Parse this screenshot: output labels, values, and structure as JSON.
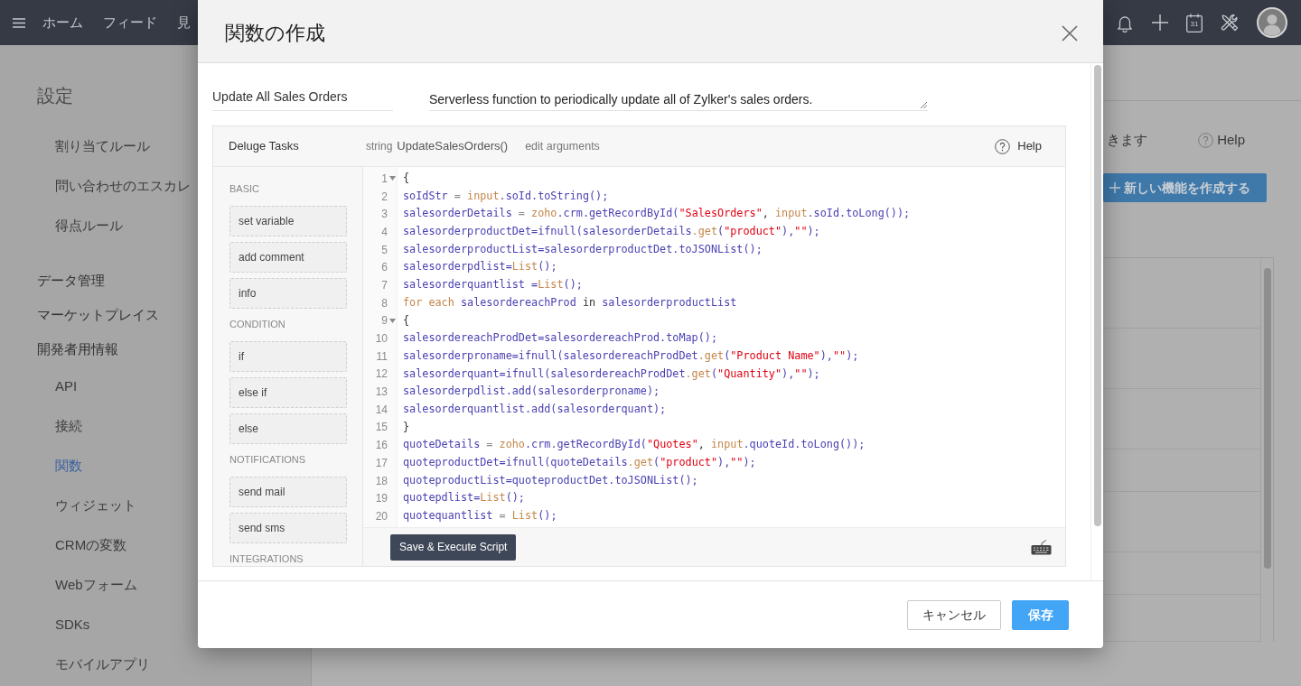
{
  "topbar": {
    "nav": [
      {
        "label": "ホーム",
        "selected": false
      },
      {
        "label": "フィード",
        "selected": false
      },
      {
        "label": "見",
        "selected": false
      }
    ],
    "calendar_day": "31"
  },
  "sidebar": {
    "title": "設定",
    "sections": [
      {
        "items": [
          {
            "label": "割り当てルール",
            "selected": false
          },
          {
            "label": "問い合わせのエスカレ",
            "selected": false
          },
          {
            "label": "得点ルール",
            "selected": false
          }
        ]
      },
      {
        "heading": "データ管理"
      },
      {
        "heading": "マーケットプレイス"
      },
      {
        "heading": "開発者用情報",
        "items": [
          {
            "label": "API",
            "selected": false
          },
          {
            "label": "接続",
            "selected": false
          },
          {
            "label": "関数",
            "selected": true
          },
          {
            "label": "ウィジェット",
            "selected": false
          },
          {
            "label": "CRMの変数",
            "selected": false
          },
          {
            "label": "Webフォーム",
            "selected": false
          },
          {
            "label": "SDKs",
            "selected": false
          },
          {
            "label": "モバイルアプリ",
            "selected": false
          }
        ]
      }
    ]
  },
  "main": {
    "description": "きます",
    "help": "Help",
    "create_button": "新しい機能を作成する"
  },
  "dialog": {
    "title": "関数の作成",
    "name": "Update All Sales Orders",
    "description": "Serverless function to periodically update all of Zylker's sales orders.",
    "editor": {
      "title": "Deluge Tasks",
      "return_type": "string",
      "signature": "UpdateSalesOrders()",
      "edit_link": "edit arguments",
      "help": "Help",
      "palette": [
        {
          "heading": "BASIC",
          "tasks": [
            "set variable",
            "add comment",
            "info"
          ]
        },
        {
          "heading": "CONDITION",
          "tasks": [
            "if",
            "else if",
            "else"
          ]
        },
        {
          "heading": "NOTIFICATIONS",
          "tasks": [
            "send mail",
            "send sms"
          ]
        },
        {
          "heading": "INTEGRATIONS"
        }
      ],
      "lines": [
        {
          "number": "1",
          "foldable": true,
          "tokens": [
            {
              "text": "{",
              "kind": "plain"
            }
          ]
        },
        {
          "number": "2",
          "foldable": false,
          "tokens": [
            {
              "text": "soIdStr",
              "kind": "ident"
            },
            {
              "text": " = ",
              "kind": "operator"
            },
            {
              "text": "input",
              "kind": "builtin"
            },
            {
              "text": ".soId.toString();",
              "kind": "ident"
            }
          ]
        },
        {
          "number": "3",
          "foldable": false,
          "tokens": [
            {
              "text": "salesorderDetails",
              "kind": "ident"
            },
            {
              "text": " = ",
              "kind": "operator"
            },
            {
              "text": "zoho",
              "kind": "builtin"
            },
            {
              "text": ".crm.getRecordById(",
              "kind": "ident"
            },
            {
              "text": "\"SalesOrders\"",
              "kind": "string"
            },
            {
              "text": ", ",
              "kind": "plain"
            },
            {
              "text": "input",
              "kind": "builtin"
            },
            {
              "text": ".soId.toLong());",
              "kind": "ident"
            }
          ]
        },
        {
          "number": "4",
          "foldable": false,
          "tokens": [
            {
              "text": "salesorderproductDet=ifnull(salesorderDetails",
              "kind": "ident"
            },
            {
              "text": ".get",
              "kind": "builtin"
            },
            {
              "text": "(",
              "kind": "ident"
            },
            {
              "text": "\"product\"",
              "kind": "string"
            },
            {
              "text": "),",
              "kind": "ident"
            },
            {
              "text": "\"\"",
              "kind": "string"
            },
            {
              "text": ");",
              "kind": "ident"
            }
          ]
        },
        {
          "number": "5",
          "foldable": false,
          "tokens": [
            {
              "text": "salesorderproductList=salesorderproductDet.toJSONList();",
              "kind": "ident"
            }
          ]
        },
        {
          "number": "6",
          "foldable": false,
          "tokens": [
            {
              "text": "salesorderpdlist=",
              "kind": "ident"
            },
            {
              "text": "List",
              "kind": "builtin"
            },
            {
              "text": "();",
              "kind": "ident"
            }
          ]
        },
        {
          "number": "7",
          "foldable": false,
          "tokens": [
            {
              "text": "salesorderquantlist =",
              "kind": "ident"
            },
            {
              "text": "List",
              "kind": "builtin"
            },
            {
              "text": "();",
              "kind": "ident"
            }
          ]
        },
        {
          "number": "8",
          "foldable": false,
          "tokens": [
            {
              "text": "for each",
              "kind": "keyword"
            },
            {
              "text": " salesordereachProd ",
              "kind": "ident"
            },
            {
              "text": "in",
              "kind": "plain"
            },
            {
              "text": " salesorderproductList",
              "kind": "ident"
            }
          ]
        },
        {
          "number": "9",
          "foldable": true,
          "tokens": [
            {
              "text": "{",
              "kind": "plain"
            }
          ]
        },
        {
          "number": "10",
          "foldable": false,
          "tokens": [
            {
              "text": "salesordereachProdDet=salesordereachProd.toMap();",
              "kind": "ident"
            }
          ]
        },
        {
          "number": "11",
          "foldable": false,
          "tokens": [
            {
              "text": "salesorderproname=ifnull(salesordereachProdDet",
              "kind": "ident"
            },
            {
              "text": ".get",
              "kind": "builtin"
            },
            {
              "text": "(",
              "kind": "ident"
            },
            {
              "text": "\"Product Name\"",
              "kind": "string"
            },
            {
              "text": "),",
              "kind": "ident"
            },
            {
              "text": "\"\"",
              "kind": "string"
            },
            {
              "text": ");",
              "kind": "ident"
            }
          ]
        },
        {
          "number": "12",
          "foldable": false,
          "tokens": [
            {
              "text": "salesorderquant=ifnull(salesordereachProdDet",
              "kind": "ident"
            },
            {
              "text": ".get",
              "kind": "builtin"
            },
            {
              "text": "(",
              "kind": "ident"
            },
            {
              "text": "\"Quantity\"",
              "kind": "string"
            },
            {
              "text": "),",
              "kind": "ident"
            },
            {
              "text": "\"\"",
              "kind": "string"
            },
            {
              "text": ");",
              "kind": "ident"
            }
          ]
        },
        {
          "number": "13",
          "foldable": false,
          "tokens": [
            {
              "text": "salesorderpdlist.add(salesorderproname);",
              "kind": "ident"
            }
          ]
        },
        {
          "number": "14",
          "foldable": false,
          "tokens": [
            {
              "text": "salesorderquantlist.add(salesorderquant);",
              "kind": "ident"
            }
          ]
        },
        {
          "number": "15",
          "foldable": false,
          "tokens": [
            {
              "text": "}",
              "kind": "plain"
            }
          ]
        },
        {
          "number": "16",
          "foldable": false,
          "tokens": [
            {
              "text": "quoteDetails",
              "kind": "ident"
            },
            {
              "text": " = ",
              "kind": "operator"
            },
            {
              "text": "zoho",
              "kind": "builtin"
            },
            {
              "text": ".crm.getRecordById(",
              "kind": "ident"
            },
            {
              "text": "\"Quotes\"",
              "kind": "string"
            },
            {
              "text": ", ",
              "kind": "plain"
            },
            {
              "text": "input",
              "kind": "builtin"
            },
            {
              "text": ".quoteId.toLong());",
              "kind": "ident"
            }
          ]
        },
        {
          "number": "17",
          "foldable": false,
          "tokens": [
            {
              "text": "quoteproductDet=ifnull(quoteDetails",
              "kind": "ident"
            },
            {
              "text": ".get",
              "kind": "builtin"
            },
            {
              "text": "(",
              "kind": "ident"
            },
            {
              "text": "\"product\"",
              "kind": "string"
            },
            {
              "text": "),",
              "kind": "ident"
            },
            {
              "text": "\"\"",
              "kind": "string"
            },
            {
              "text": ");",
              "kind": "ident"
            }
          ]
        },
        {
          "number": "18",
          "foldable": false,
          "tokens": [
            {
              "text": "quoteproductList=quoteproductDet.toJSONList();",
              "kind": "ident"
            }
          ]
        },
        {
          "number": "19",
          "foldable": false,
          "tokens": [
            {
              "text": "quotepdlist=",
              "kind": "ident"
            },
            {
              "text": "List",
              "kind": "builtin"
            },
            {
              "text": "();",
              "kind": "ident"
            }
          ]
        },
        {
          "number": "20",
          "foldable": false,
          "tokens": [
            {
              "text": "quotequantlist",
              "kind": "ident"
            },
            {
              "text": " = ",
              "kind": "operator"
            },
            {
              "text": "List",
              "kind": "builtin"
            },
            {
              "text": "();",
              "kind": "ident"
            }
          ]
        }
      ],
      "run_button": "Save & Execute Script"
    },
    "buttons": [
      {
        "label": "キャンセル",
        "kind": "secondary"
      },
      {
        "label": "保存",
        "kind": "primary"
      }
    ]
  }
}
